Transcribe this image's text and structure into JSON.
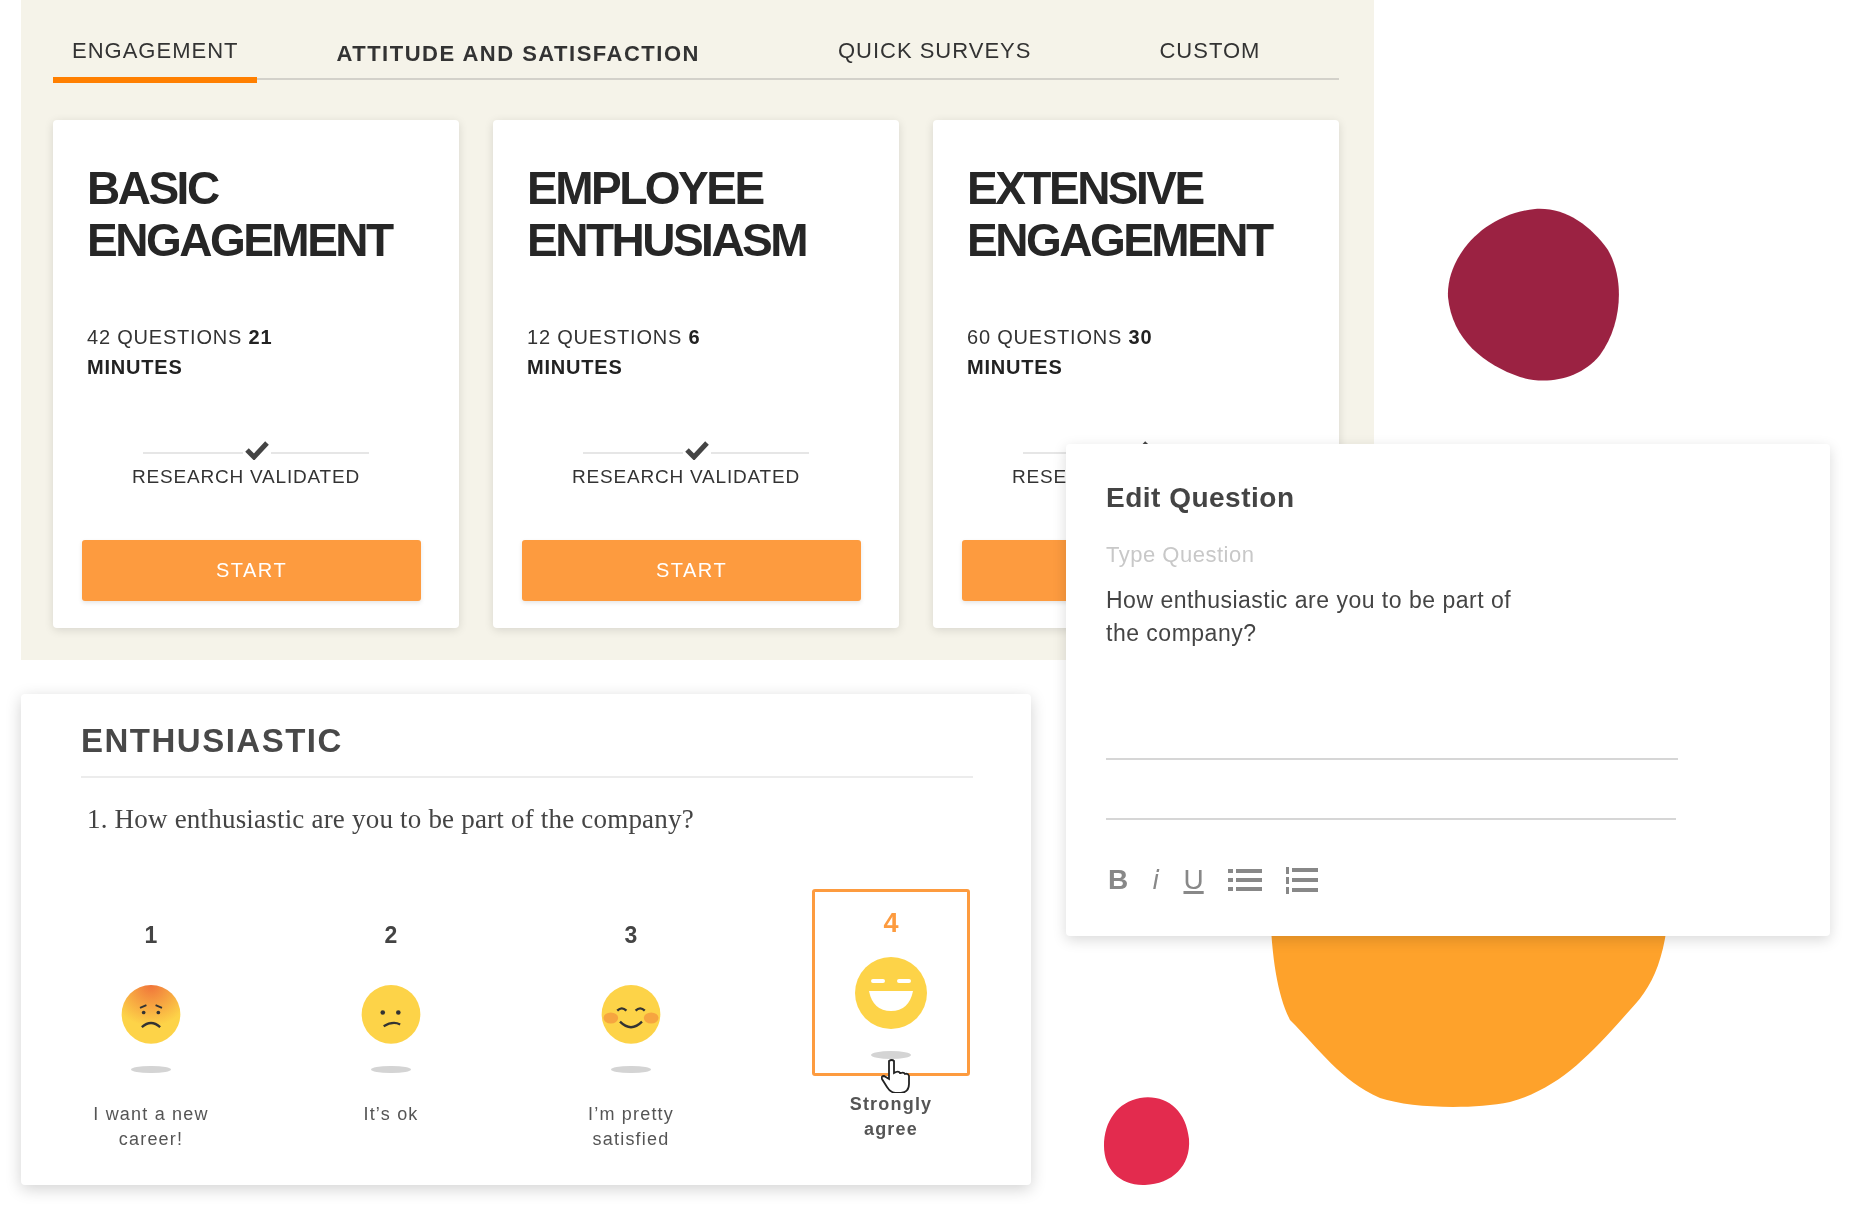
{
  "tabs": [
    {
      "label": "ENGAGEMENT",
      "selected": true,
      "emphasized": false
    },
    {
      "label": "ATTITUDE AND SATISFACTION",
      "selected": false,
      "emphasized": true
    },
    {
      "label": "QUICK SURVEYS",
      "selected": false,
      "emphasized": false
    },
    {
      "label": "CUSTOM",
      "selected": false,
      "emphasized": false
    }
  ],
  "cards": [
    {
      "title": "BASIC ENGAGEMENT",
      "meta": "42 QUESTIONS **21 MINUTES**",
      "validated": "RESEARCH VALIDATED",
      "button": "START"
    },
    {
      "title": "EMPLOYEE ENTHUSIASM",
      "meta": "12 QUESTIONS **6 MINUTES**",
      "validated": "RESEARCH VALIDATED",
      "button": "START"
    },
    {
      "title": "EXTENSIVE ENGAGEMENT",
      "meta": "60 QUESTIONS **30 MINUTES**",
      "validated": "RESE"
    }
  ],
  "edit_question": {
    "title": "Edit Question",
    "field": {
      "label": "Type Question",
      "value": "How enthusiastic are you to be part of the company?"
    },
    "toolbar": [
      {
        "kind": "bold",
        "label": "B"
      },
      {
        "kind": "italic",
        "label": "i"
      },
      {
        "kind": "underline",
        "label": "U"
      },
      {
        "kind": "bullet-list"
      },
      {
        "kind": "numbered-list"
      }
    ]
  },
  "rating": {
    "title": "ENTHUSIASTIC",
    "question": "1. How enthusiastic are you to be part of the company?",
    "options": [
      {
        "number": "1",
        "label": "I want a new career!",
        "kind": "worried",
        "selected": false
      },
      {
        "number": "2",
        "label": "It’s ok",
        "kind": "unsure",
        "selected": false
      },
      {
        "number": "3",
        "label": "I’m pretty satisfied",
        "kind": "smiling",
        "selected": false
      },
      {
        "number": "4",
        "label": "Strongly agree",
        "kind": "grinning",
        "selected": true
      }
    ]
  }
}
